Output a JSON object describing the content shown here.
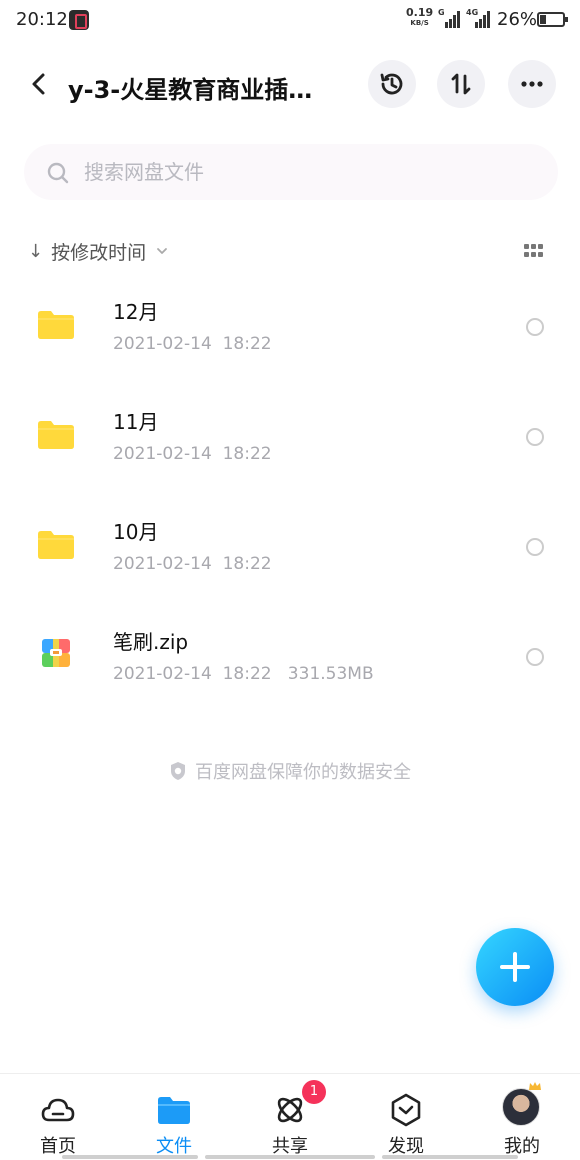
{
  "status_bar": {
    "time": "20:12",
    "net_speed_value": "0.19",
    "net_speed_unit": "KB/S",
    "signal1_label": "G",
    "signal2_label": "4G",
    "battery_percent": "26%",
    "battery_level": 0.26
  },
  "header": {
    "title": "y-3-火星教育商业插…",
    "history_icon": "history-icon",
    "transfer_icon": "transfer-icon",
    "more_icon": "more-icon"
  },
  "search": {
    "placeholder": "搜索网盘文件"
  },
  "sort": {
    "label": "按修改时间"
  },
  "files": [
    {
      "name": "12月",
      "meta": "2021-02-14  18:22",
      "type": "folder"
    },
    {
      "name": "11月",
      "meta": "2021-02-14  18:22",
      "type": "folder"
    },
    {
      "name": "10月",
      "meta": "2021-02-14  18:22",
      "type": "folder"
    },
    {
      "name": "笔刷.zip",
      "meta": "2021-02-14  18:22   331.53MB",
      "type": "zip"
    }
  ],
  "safety_notice": "百度网盘保障你的数据安全",
  "bottom_nav": {
    "items": [
      {
        "label": "首页",
        "icon": "cloud-icon"
      },
      {
        "label": "文件",
        "icon": "folder-icon"
      },
      {
        "label": "共享",
        "icon": "atom-icon"
      },
      {
        "label": "发现",
        "icon": "compass-icon"
      },
      {
        "label": "我的",
        "icon": "avatar"
      }
    ],
    "share_badge": "1"
  },
  "colors": {
    "accent": "#0a8df5",
    "folder": "#ffd93b",
    "badge": "#f5325a"
  }
}
